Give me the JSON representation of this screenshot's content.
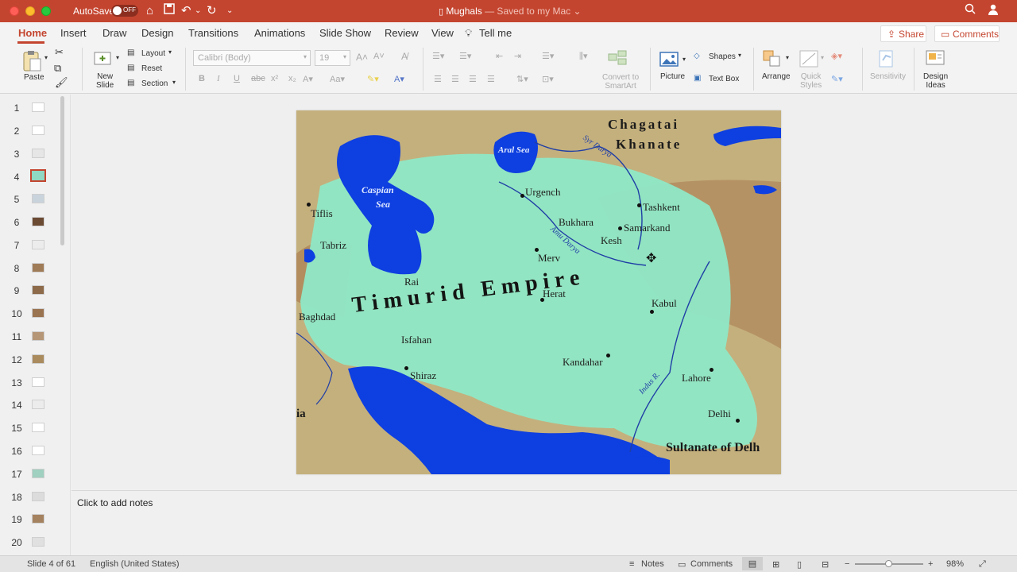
{
  "titlebar": {
    "autosave_label": "AutoSave",
    "autosave_state": "OFF",
    "doc_name": "Mughals",
    "saved_status": " — Saved to my Mac ⌄"
  },
  "tabs": [
    {
      "label": "Home",
      "active": true
    },
    {
      "label": "Insert"
    },
    {
      "label": "Draw"
    },
    {
      "label": "Design"
    },
    {
      "label": "Transitions"
    },
    {
      "label": "Animations"
    },
    {
      "label": "Slide Show"
    },
    {
      "label": "Review"
    },
    {
      "label": "View"
    },
    {
      "label": "Tell me"
    }
  ],
  "header_buttons": {
    "share": "Share",
    "comments": "Comments"
  },
  "ribbon": {
    "paste": "Paste",
    "new_slide": "New\nSlide",
    "layout": "Layout",
    "reset": "Reset",
    "section": "Section",
    "font_name": "Calibri (Body)",
    "font_size": "19",
    "convert_smartart": "Convert to\nSmartArt",
    "picture": "Picture",
    "shapes": "Shapes",
    "text_box": "Text Box",
    "arrange": "Arrange",
    "quick_styles": "Quick\nStyles",
    "sensitivity": "Sensitivity",
    "design_ideas": "Design\nIdeas"
  },
  "slides": {
    "numbers": [
      "1",
      "2",
      "3",
      "4",
      "5",
      "6",
      "7",
      "8",
      "9",
      "10",
      "11",
      "12",
      "13",
      "14",
      "15",
      "16",
      "17",
      "18",
      "19",
      "20"
    ],
    "active_index": 4
  },
  "map": {
    "regions": {
      "chagatai": "Chagatai",
      "khanate": "Khanate",
      "empire": "Timurid Empire",
      "sultanate": "Sultanate of Delh",
      "edge_left": "ia"
    },
    "seas": {
      "caspian_1": "Caspian",
      "caspian_2": "Sea",
      "aral": "Aral Sea"
    },
    "rivers": {
      "syr": "Syr Darya",
      "amu": "Amu Darya",
      "indus": "Indus R."
    },
    "cities": {
      "urgench": "Urgench",
      "tashkent": "Tashkent",
      "bukhara": "Bukhara",
      "samarkand": "Samarkand",
      "kesh": "Kesh",
      "tiflis": "Tiflis",
      "tabriz": "Tabriz",
      "merv": "Merv",
      "rai": "Rai",
      "herat": "Herat",
      "kabul": "Kabul",
      "baghdad": "Baghdad",
      "isfahan": "Isfahan",
      "kandahar": "Kandahar",
      "shiraz": "Shiraz",
      "lahore": "Lahore",
      "delhi": "Delhi"
    }
  },
  "notes_placeholder": "Click to add notes",
  "status": {
    "slide_info": "Slide 4 of 61",
    "language": "English (United States)",
    "notes": "Notes",
    "comments": "Comments",
    "zoom": "98%"
  }
}
